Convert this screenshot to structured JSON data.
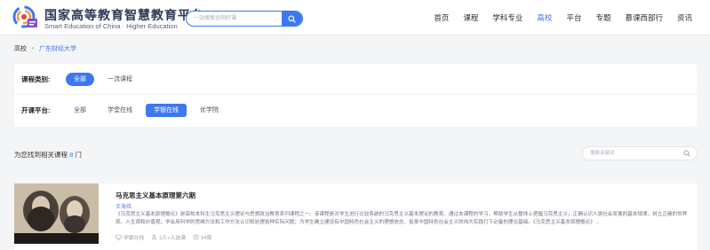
{
  "header": {
    "logo_cn": "国家高等教育智慧教育平台",
    "logo_en": "Smart Education of China · Higher Education",
    "search_placeholder": "一站搜索全网好课",
    "nav": [
      {
        "label": "首页",
        "active": false
      },
      {
        "label": "课程",
        "active": false
      },
      {
        "label": "学科专业",
        "active": false
      },
      {
        "label": "高校",
        "active": true
      },
      {
        "label": "平台",
        "active": false
      },
      {
        "label": "专题",
        "active": false
      },
      {
        "label": "慕课西部行",
        "active": false
      },
      {
        "label": "资讯",
        "active": false
      }
    ],
    "accent_color": "#3d78f0"
  },
  "breadcrumb": {
    "root": "高校",
    "current": "广东财经大学"
  },
  "filters": {
    "category_label": "课程类别:",
    "category_options": [
      "全部",
      "一流课程"
    ],
    "category_selected": "全部",
    "platform_label": "开课平台:",
    "platform_options": [
      "全部",
      "学堂在线",
      "学银在线",
      "优学院"
    ],
    "platform_selected": "学银在线"
  },
  "results": {
    "prefix": "为您找到相关课程",
    "count": "8",
    "suffix": "门",
    "keyword_placeholder": "搜索关键词"
  },
  "course": {
    "title": "马克思主义基本原理第六期",
    "teacher": "王海伟",
    "description": "《马克思主义基本原理概论》是高校本科生马克思主义理论与思想政治教育系列课程之一。该课程是对学生进行比较系统的马克思主义基本理论的教育。通过本课程的学习，帮助学生从整体上把握马克思主义，正确认识人类社会发展的基本规律，树立正确的世界观、人生观和价值观；学会用科学的思维方法和工作方法认识和处理各种实际问题；为学生确立建设有中国特色社会主义的理想信念、投身中国特色社会主义的伟大实践打下必备的理论基础。《马克思主义基本原理概论》...",
    "platform": "学银在线",
    "learners": "1万+人选课",
    "duration": "24周"
  }
}
